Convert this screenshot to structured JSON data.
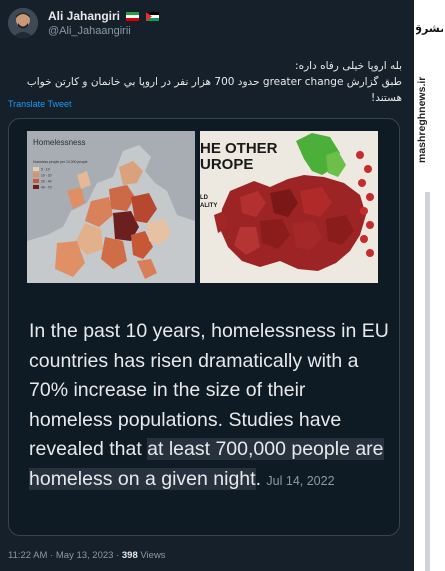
{
  "tweet": {
    "author_name": "Ali Jahangiri",
    "author_handle": "@Ali_Jahaangirii",
    "text_line1": "بله اروپا خیلی رفاه داره:",
    "text_line2": "طبق گزارش greater change حدود 700 هزار نفر در اروپا بي خانمان و کارتن خواب هستند!",
    "translate_label": "Translate Tweet",
    "timestamp": "11:22 AM · May 13, 2023 · ",
    "views_count": "398",
    "views_label": " Views"
  },
  "card": {
    "map1_title": "Homelessness",
    "map1_legend_title": "Homeless people per 10,000 people",
    "map1_legend_items": [
      "5 - 10",
      "10 - 20",
      "20 - 40",
      "40 - 70"
    ],
    "map2_title_line1": "HE OTHER",
    "map2_title_line2": "UROPE",
    "map2_side_label1": "LD",
    "map2_side_label2": "ALITY",
    "text_before": "In the past 10 years, homelessness in EU countries has risen dramatically with a 70% increase in the size of their homeless populations. Studies have revealed that ",
    "text_highlight": "at least 700,000 people are homeless on a given night",
    "text_after": ".",
    "date": "Jul 14, 2022"
  },
  "watermark": {
    "logo_text": "مشرق",
    "site": "mashreghnews.ir"
  },
  "colors": {
    "background": "#15202b",
    "link": "#1d9bf0",
    "muted": "#8b98a5",
    "map_red_dark": "#8b1c1c",
    "map_green": "#4caf3a"
  }
}
